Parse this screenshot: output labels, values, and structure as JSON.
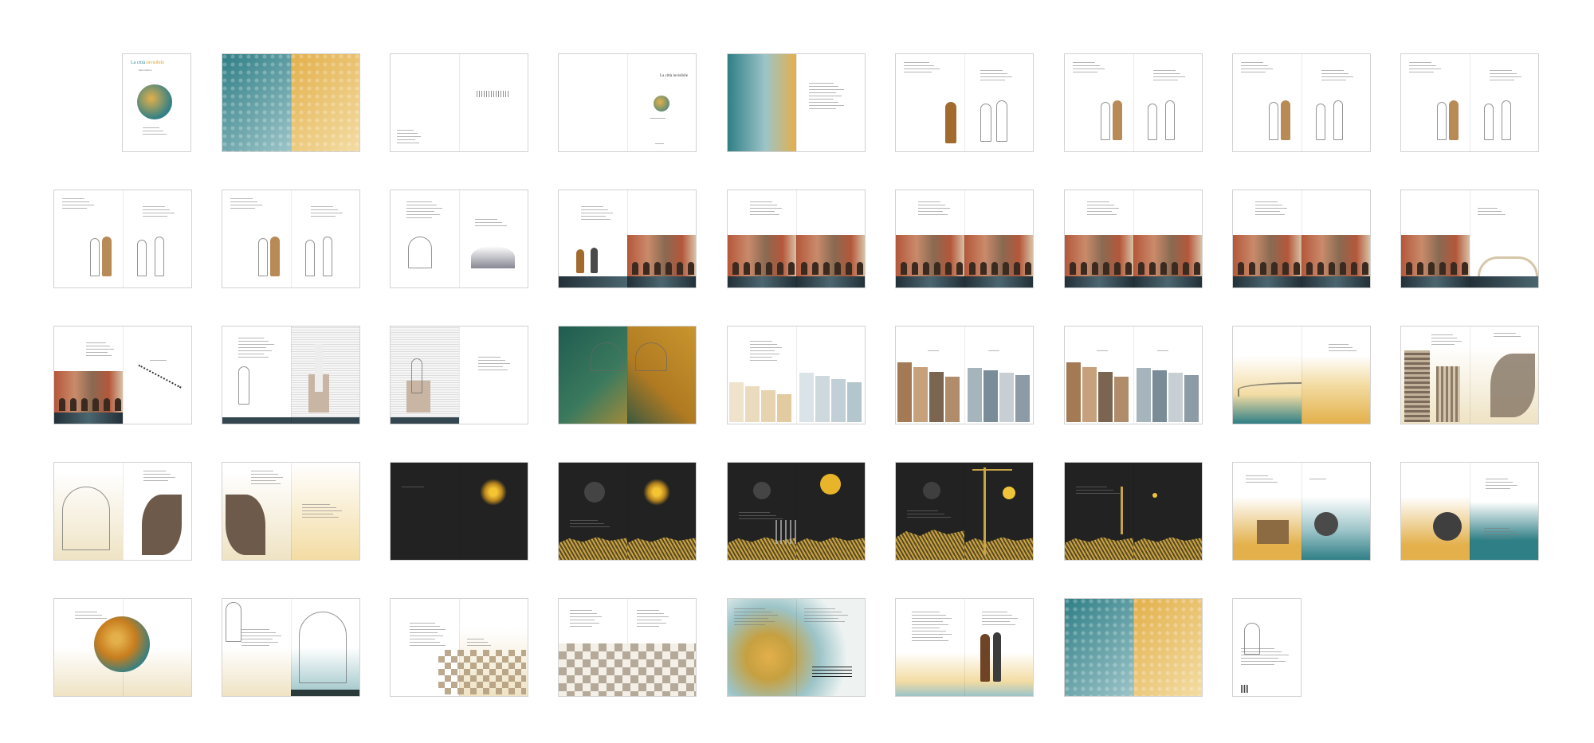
{
  "cover": {
    "title_main": "La città ",
    "title_accent": "invisibile",
    "subtitle": "Italo Calvino"
  },
  "inner_title": "La città invisibile",
  "colors": {
    "teal": "#2f7f86",
    "teal_light": "#9cc4c8",
    "gold": "#e3b04b",
    "gold_light": "#f3dca3",
    "brick": "#b5573a",
    "dark": "#222222",
    "sand": "#efe3c4",
    "border": "#d2d2d2"
  },
  "rows": [
    [
      "cover",
      "pattern-teal-gold",
      "blank-text",
      "title-globe",
      "pattern-teal-text",
      "figure-pair",
      "figures-sketch",
      "figures-sketch",
      "figures-sketch"
    ],
    [
      "figures-sketch",
      "figures-sketch",
      "dancer",
      "venice-left",
      "venice",
      "venice",
      "venice",
      "venice",
      "venice-bridge"
    ],
    [
      "venice-bridge-left",
      "lighthouse",
      "lighthouse-text",
      "hands",
      "houses-white",
      "houses-color",
      "houses-color",
      "pipe-gold",
      "tower-leaf"
    ],
    [
      "trees-leaf",
      "leaf-gold",
      "night-sun",
      "night-moons",
      "night-city",
      "night-crane",
      "night-spiral",
      "gold-domes",
      "teal-domes"
    ],
    [
      "globe-text",
      "tree",
      "checker",
      "checker-text",
      "gold-burst",
      "couple",
      "pattern-teal-gold",
      "single-back"
    ]
  ]
}
